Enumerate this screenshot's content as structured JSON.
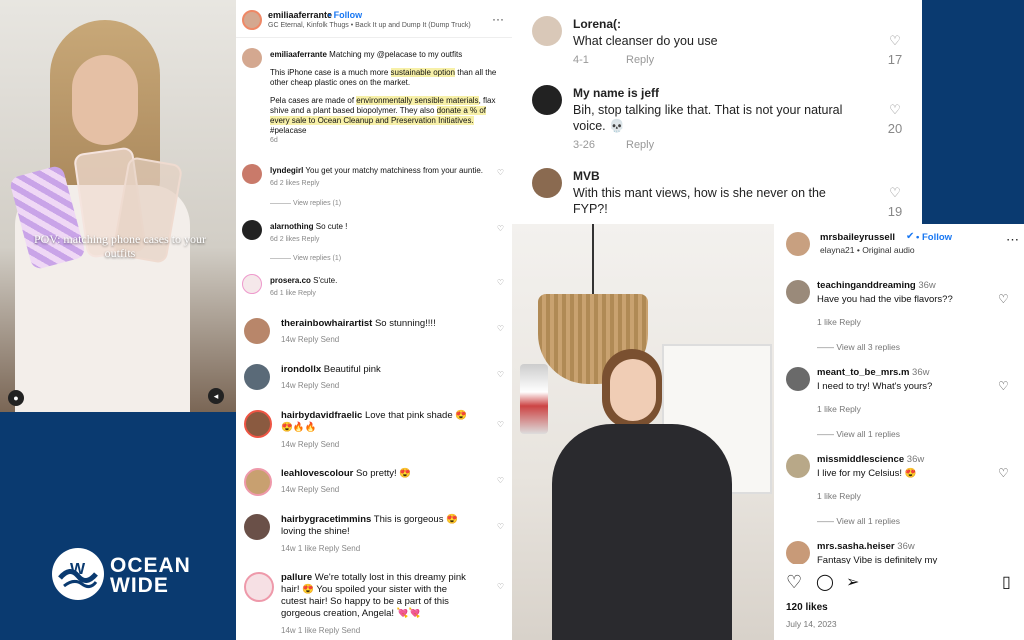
{
  "left_video": {
    "caption": "POV: matching phone cases to your outfits"
  },
  "brand": {
    "line1": "OCEAN",
    "line2": "WIDE"
  },
  "ig_post": {
    "username": "emiliaaferrante",
    "follow": "Follow",
    "audio": "GC Eternal, Kinfolk Thugs • Back It up and Dump It (Dump Truck)",
    "caption_user": "emiliaaferrante",
    "caption_lead": "Matching my @pelacase to my outfits",
    "p1a": "This iPhone case is a much more ",
    "p1b": "sustainable option",
    "p1c": " than all the other cheap plastic ones on the market.",
    "p2a": "Pela cases are made of ",
    "p2b": "environmentally sensible materials",
    "p2c": ", flax shive and a plant based biopolymer. They also ",
    "p2d": "donate a % of every sale to Ocean Cleanup and Preservation Initiatives.",
    "tag": "#pelacase",
    "age": "6d",
    "comments": [
      {
        "user": "lyndegirl",
        "text": "You get your matchy matchiness from your auntie.",
        "meta": "6d  2 likes  Reply",
        "replies": "View replies (1)"
      },
      {
        "user": "alarnothing",
        "text": "So cute !",
        "meta": "6d  2 likes  Reply",
        "replies": "View replies (1)"
      },
      {
        "user": "prosera.co",
        "text": "S'cute.",
        "meta": "6d  1 like  Reply"
      }
    ],
    "comments2": [
      {
        "user": "therainbowhairartist",
        "text": "So stunning!!!!",
        "meta": "14w     Reply     Send"
      },
      {
        "user": "irondollx",
        "text": "Beautiful pink",
        "meta": "14w     Reply     Send"
      },
      {
        "user": "hairbydavidfraelic",
        "text": "Love that pink shade 😍",
        "text2": "😍🔥🔥",
        "meta": "14w     Reply     Send"
      },
      {
        "user": "leahlovescolour",
        "text": "So pretty! 😍",
        "meta": "14w     Reply     Send"
      },
      {
        "user": "hairbygracetimmins",
        "text": "This is gorgeous 😍",
        "text2": "loving the shine!",
        "meta": "14w     1 like     Reply     Send"
      },
      {
        "user": "pallure",
        "text": "We're totally lost in this dreamy pink",
        "text2": "hair! 😍 You spoiled your sister with the",
        "text3": "cutest hair! So happy to be a part of this",
        "text4": "gorgeous creation, Angela! 💘💘",
        "meta": "14w     1 like     Reply     Send"
      }
    ]
  },
  "tiktok": {
    "comments": [
      {
        "user": "Lorena(:",
        "text": "What cleanser do you use",
        "date": "4-1",
        "reply": "Reply",
        "likes": "17"
      },
      {
        "user": "My name is jeff",
        "text": "Bih, stop talking like that. That is not your natural",
        "text2": "voice. 💀",
        "date": "3-26",
        "reply": "Reply",
        "likes": "20"
      },
      {
        "user": "MVB",
        "text": "With this mant views, how is she never on the",
        "text2": "FYP?!",
        "likes": "19"
      }
    ]
  },
  "ig2": {
    "username": "mrsbaileyrussell",
    "follow": "Follow",
    "audio": "elayna21 • Original audio",
    "comments": [
      {
        "user": "teachinganddreaming",
        "age": "36w",
        "text": "Have you had the vibe flavors??",
        "meta": "1 like    Reply",
        "replies": "View all 3 replies"
      },
      {
        "user": "meant_to_be_mrs.m",
        "age": "36w",
        "text": "I need to try! What's yours?",
        "meta": "1 like    Reply",
        "replies": "View all 1 replies"
      },
      {
        "user": "missmiddlescience",
        "age": "36w",
        "text": "I live for my Celsius! 😍",
        "meta": "1 like    Reply",
        "replies": "View all 1 replies"
      },
      {
        "user": "mrs.sasha.heiser",
        "age": "36w",
        "text": "Fantasy Vibe is definitely my"
      }
    ],
    "likes": "120 likes",
    "date": "July 14, 2023"
  },
  "colors": {
    "background": "#0a3a70",
    "follow": "#1877f2",
    "highlight": "#f7f0a8"
  }
}
